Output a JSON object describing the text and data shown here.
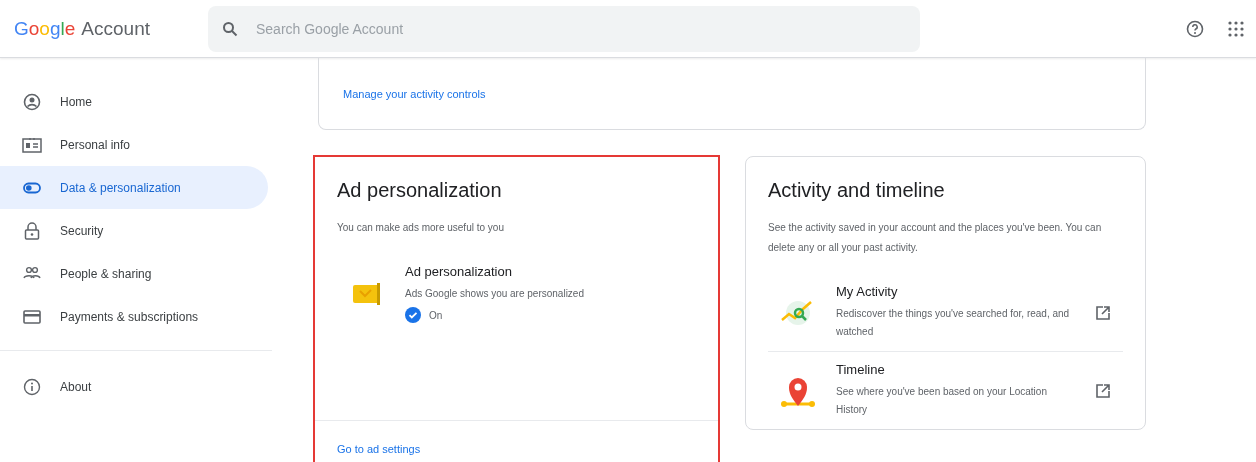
{
  "header": {
    "logo": "Google",
    "product": "Account",
    "search": {
      "placeholder": "Search Google Account"
    }
  },
  "sidebar": {
    "items": [
      {
        "label": "Home",
        "selected": false
      },
      {
        "label": "Personal info",
        "selected": false
      },
      {
        "label": "Data & personalization",
        "selected": true
      },
      {
        "label": "Security",
        "selected": false
      },
      {
        "label": "People & sharing",
        "selected": false
      },
      {
        "label": "Payments & subscriptions",
        "selected": false
      },
      {
        "label": "About",
        "selected": false
      }
    ]
  },
  "top_card": {
    "link": "Manage your activity controls"
  },
  "cards": [
    {
      "title": "Ad personalization",
      "description": "You can make ads more useful to you",
      "highlighted": true,
      "items": [
        {
          "title": "Ad personalization",
          "description": "Ads Google shows you are personalized",
          "status": "On",
          "external": false
        }
      ],
      "link": "Go to ad settings"
    },
    {
      "title": "Activity and timeline",
      "description": "See the activity saved in your account and the places you've been. You can delete any or all your past activity.",
      "highlighted": false,
      "items": [
        {
          "title": "My Activity",
          "description": "Rediscover the things you've searched for, read, and watched",
          "external": true
        },
        {
          "title": "Timeline",
          "description": "See where you've been based on your Location History",
          "external": true
        }
      ]
    }
  ]
}
